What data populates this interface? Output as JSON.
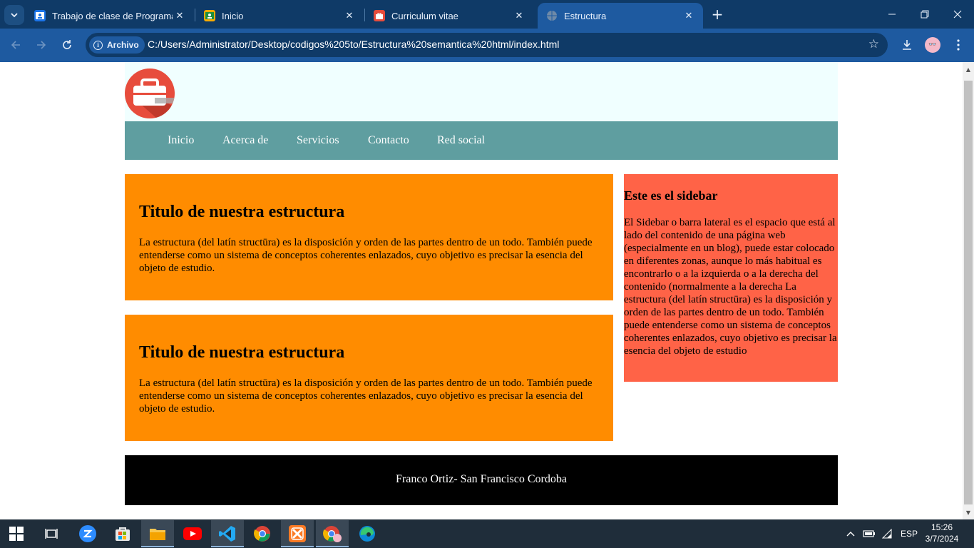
{
  "browser": {
    "tabs": [
      {
        "title": "Trabajo de clase de Programaci",
        "icon": "classroom-icon",
        "active": false
      },
      {
        "title": "Inicio",
        "icon": "classroom-icon",
        "active": false
      },
      {
        "title": "Curriculum vitae",
        "icon": "briefcase-icon",
        "active": false
      },
      {
        "title": "Estructura",
        "icon": "globe-icon",
        "active": true
      }
    ],
    "security_chip": "Archivo",
    "url": "C:/Users/Administrator/Desktop/codigos%205to/Estructura%20semantica%20html/index.html"
  },
  "site": {
    "nav": [
      "Inicio",
      "Acerca de",
      "Servicios",
      "Contacto",
      "Red social"
    ],
    "articles": [
      {
        "title": "Titulo de nuestra estructura",
        "body": "La estructura (del latín structūra) es la disposición y orden de las partes dentro de un todo. También puede entenderse como un sistema de conceptos coherentes enlazados, cuyo objetivo es precisar la esencia del objeto de estudio."
      },
      {
        "title": "Titulo de nuestra estructura",
        "body": "La estructura (del latín structūra) es la disposición y orden de las partes dentro de un todo. También puede entenderse como un sistema de conceptos coherentes enlazados, cuyo objetivo es precisar la esencia del objeto de estudio."
      }
    ],
    "sidebar": {
      "title": "Este es el sidebar",
      "body": "El Sidebar o barra lateral es el espacio que está al lado del contenido de una página web (especialmente en un blog), puede estar colocado en diferentes zonas, aunque lo más habitual es encontrarlo o a la izquierda o a la derecha del contenido (normalmente a la derecha La estructura (del latín structūra) es la disposición y orden de las partes dentro de un todo. También puede entenderse como un sistema de conceptos coherentes enlazados, cuyo objetivo es precisar la esencia del objeto de estudio"
    },
    "footer": "Franco Ortiz- San Francisco Cordoba",
    "colors": {
      "header_bg": "#f0ffff",
      "nav_bg": "#5f9ea0",
      "article_bg": "#ff8c00",
      "sidebar_bg": "#ff6347",
      "footer_bg": "#000000"
    }
  },
  "taskbar": {
    "apps": [
      "windows-start-icon",
      "task-view-icon",
      "zoom-icon",
      "microsoft-store-icon",
      "file-explorer-icon",
      "youtube-icon",
      "vscode-icon",
      "chrome-icon",
      "xampp-icon",
      "chrome-profile-icon",
      "edge-icon"
    ],
    "language": "ESP",
    "time": "15:26",
    "date": "3/7/2024"
  }
}
